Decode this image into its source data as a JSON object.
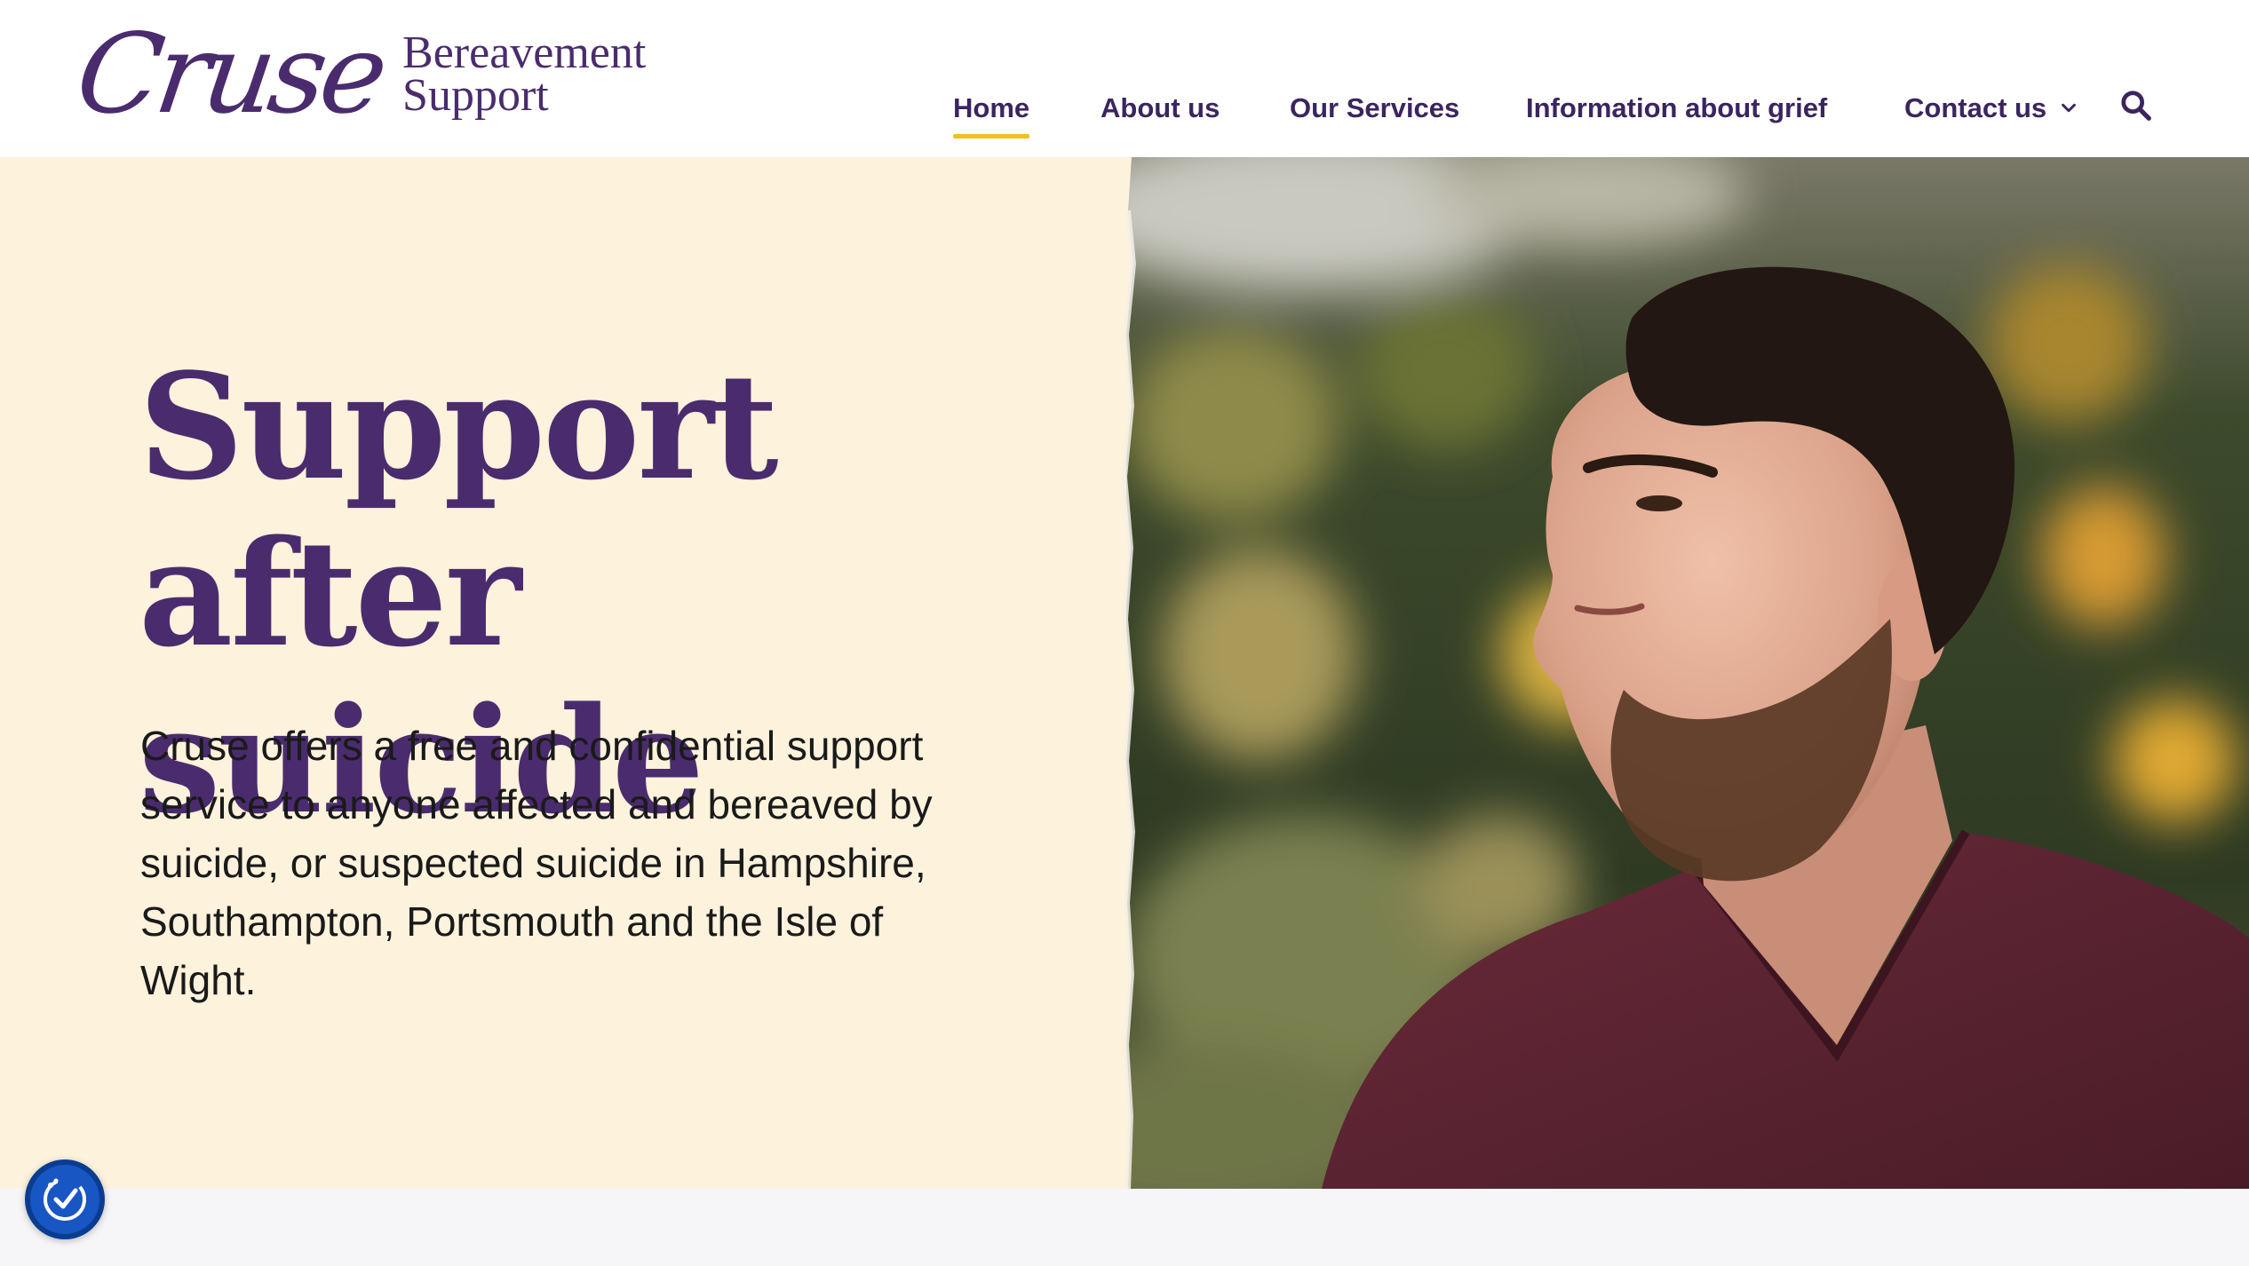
{
  "brand": {
    "script": "Cruse",
    "subtitle_line1": "Bereavement",
    "subtitle_line2": "Support",
    "color": "#4a2c6e"
  },
  "nav": {
    "items": [
      {
        "label": "Home",
        "active": true
      },
      {
        "label": "About us",
        "active": false
      },
      {
        "label": "Our Services",
        "active": false
      },
      {
        "label": "Information about grief",
        "active": false
      },
      {
        "label": "Contact us",
        "active": false,
        "dropdown": true
      }
    ],
    "accent": "#f2c01e",
    "search_icon": "search-icon"
  },
  "hero": {
    "title_line1": "Support after",
    "title_line2": "suicide",
    "body": "Cruse offers a free and confidential support service to anyone affected and bereaved by suicide, or suspected suicide in Hampshire, Southampton, Portsmouth and the Isle of Wight.",
    "background": "#fdf2dc",
    "photo_icon": "portrait-photo"
  },
  "accessibility": {
    "icon": "accessibility-icon",
    "color": "#1856c4"
  }
}
